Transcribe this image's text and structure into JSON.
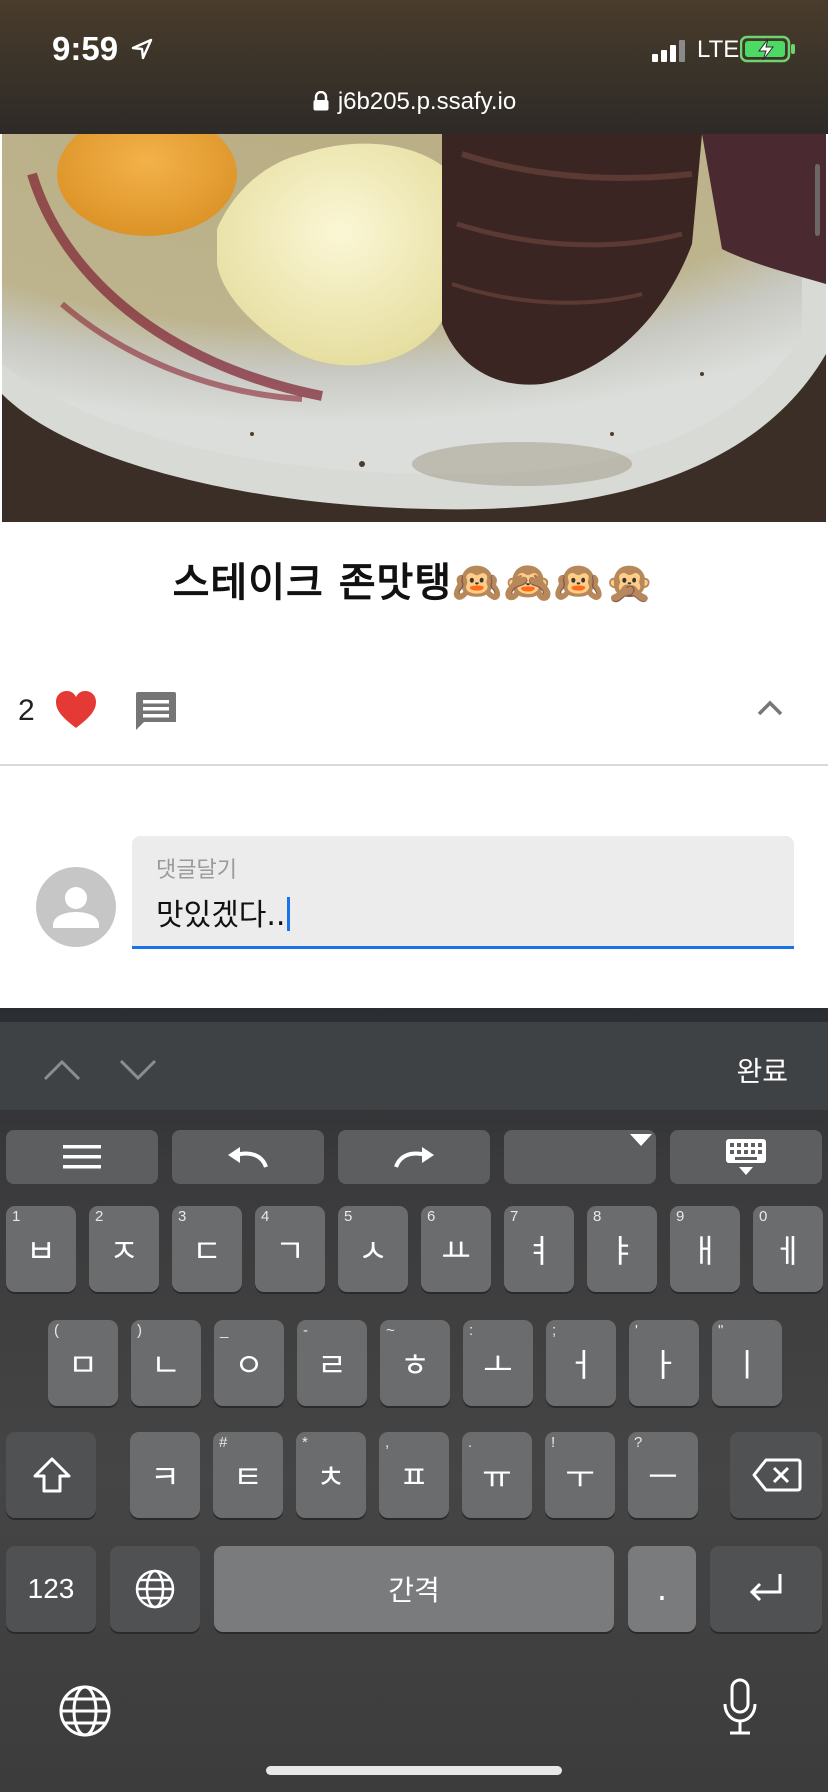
{
  "status_bar": {
    "time": "9:59",
    "network": "LTE"
  },
  "browser": {
    "url": "j6b205.p.ssafy.io"
  },
  "post": {
    "caption": "스테이크 존맛탱🙉🙈🙉🙊",
    "like_count": "2"
  },
  "comment_input": {
    "label": "댓글달기",
    "value": "맛있겠다.."
  },
  "keyboard": {
    "done_label": "완료",
    "row1": [
      {
        "hint": "1",
        "glyph": "ㅂ"
      },
      {
        "hint": "2",
        "glyph": "ㅈ"
      },
      {
        "hint": "3",
        "glyph": "ㄷ"
      },
      {
        "hint": "4",
        "glyph": "ㄱ"
      },
      {
        "hint": "5",
        "glyph": "ㅅ"
      },
      {
        "hint": "6",
        "glyph": "ㅛ"
      },
      {
        "hint": "7",
        "glyph": "ㅕ"
      },
      {
        "hint": "8",
        "glyph": "ㅑ"
      },
      {
        "hint": "9",
        "glyph": "ㅐ"
      },
      {
        "hint": "0",
        "glyph": "ㅔ"
      }
    ],
    "row2": [
      {
        "hint": "(",
        "glyph": "ㅁ"
      },
      {
        "hint": ")",
        "glyph": "ㄴ"
      },
      {
        "hint": "_",
        "glyph": "ㅇ"
      },
      {
        "hint": "-",
        "glyph": "ㄹ"
      },
      {
        "hint": "~",
        "glyph": "ㅎ"
      },
      {
        "hint": ":",
        "glyph": "ㅗ"
      },
      {
        "hint": ";",
        "glyph": "ㅓ"
      },
      {
        "hint": "'",
        "glyph": "ㅏ"
      },
      {
        "hint": "\"",
        "glyph": "ㅣ"
      }
    ],
    "row3": [
      {
        "hint": "",
        "glyph": "ㅋ"
      },
      {
        "hint": "#",
        "glyph": "ㅌ"
      },
      {
        "hint": "*",
        "glyph": "ㅊ"
      },
      {
        "hint": ",",
        "glyph": "ㅍ"
      },
      {
        "hint": ".",
        "glyph": "ㅠ"
      },
      {
        "hint": "!",
        "glyph": "ㅜ"
      },
      {
        "hint": "?",
        "glyph": "ㅡ"
      }
    ],
    "numbers_key": "123",
    "space_key": "간격",
    "period_key": "."
  }
}
